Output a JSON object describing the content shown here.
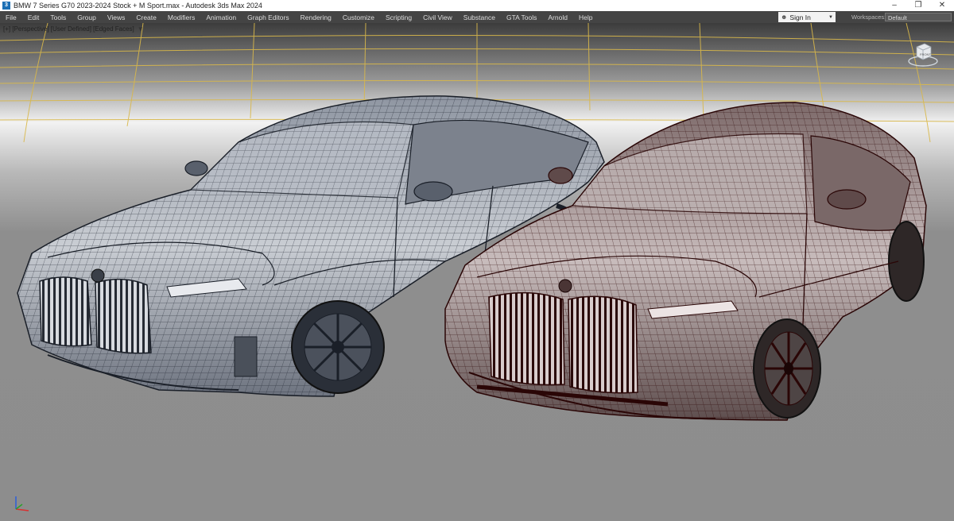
{
  "window": {
    "title": "BMW 7 Series G70 2023-2024 Stock + M Sport.max - Autodesk 3ds Max 2024",
    "app_icon": "3ds-max-logo-icon",
    "controls": [
      "minimize-icon",
      "restore-icon",
      "close-icon"
    ]
  },
  "menu": {
    "items": [
      "File",
      "Edit",
      "Tools",
      "Group",
      "Views",
      "Create",
      "Modifiers",
      "Animation",
      "Graph Editors",
      "Rendering",
      "Customize",
      "Scripting",
      "Civil View",
      "Substance",
      "GTA Tools",
      "Arnold",
      "Help"
    ]
  },
  "account": {
    "sign_in": "Sign In",
    "icon": "user-icon"
  },
  "workspaces": {
    "label": "Workspaces:",
    "value": "Default"
  },
  "viewport": {
    "label": "[+] [Perspective] [User Defined] [Edged Faces]",
    "filter_icon": "funnel-filter-icon",
    "viewcube_label": "FRONT",
    "colors": {
      "background": "#8f8f8f",
      "backdrop_grid": "#d9b84a",
      "left_wire": "#2a2f3a",
      "right_wire": "#3a0e0e"
    }
  }
}
